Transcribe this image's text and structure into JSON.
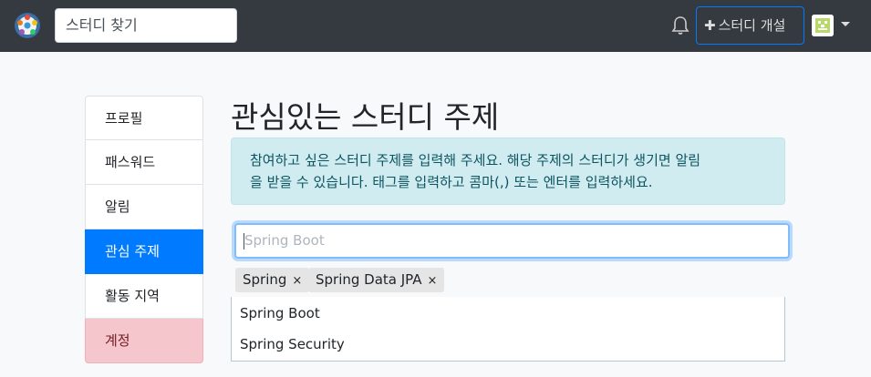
{
  "navbar": {
    "search_placeholder": "스터디 찾기",
    "create_label": "스터디 개설",
    "create_icon": "plus-icon",
    "bell_icon": "bell-icon",
    "accent": "#007bff"
  },
  "sidebar": {
    "items": [
      {
        "label": "프로필"
      },
      {
        "label": "패스워드"
      },
      {
        "label": "알림"
      },
      {
        "label": "관심 주제"
      },
      {
        "label": "활동 지역"
      },
      {
        "label": "계정"
      }
    ],
    "active": "관심 주제"
  },
  "main": {
    "title": "관심있는 스터디 주제",
    "info_line1": "참여하고 싶은 스터디 주제를 입력해 주세요. 해당 주제의 스터디가 생기면 알림",
    "info_line2": "을 받을 수 있습니다. 태그를 입력하고 콤마(,) 또는 엔터를 입력하세요.",
    "input_placeholder": "Spring Boot",
    "tags": [
      {
        "label": "Spring",
        "remove": "×"
      },
      {
        "label": "Spring Data JPA",
        "remove": "×"
      }
    ],
    "suggestions": [
      "Spring Boot",
      "Spring Security"
    ]
  }
}
